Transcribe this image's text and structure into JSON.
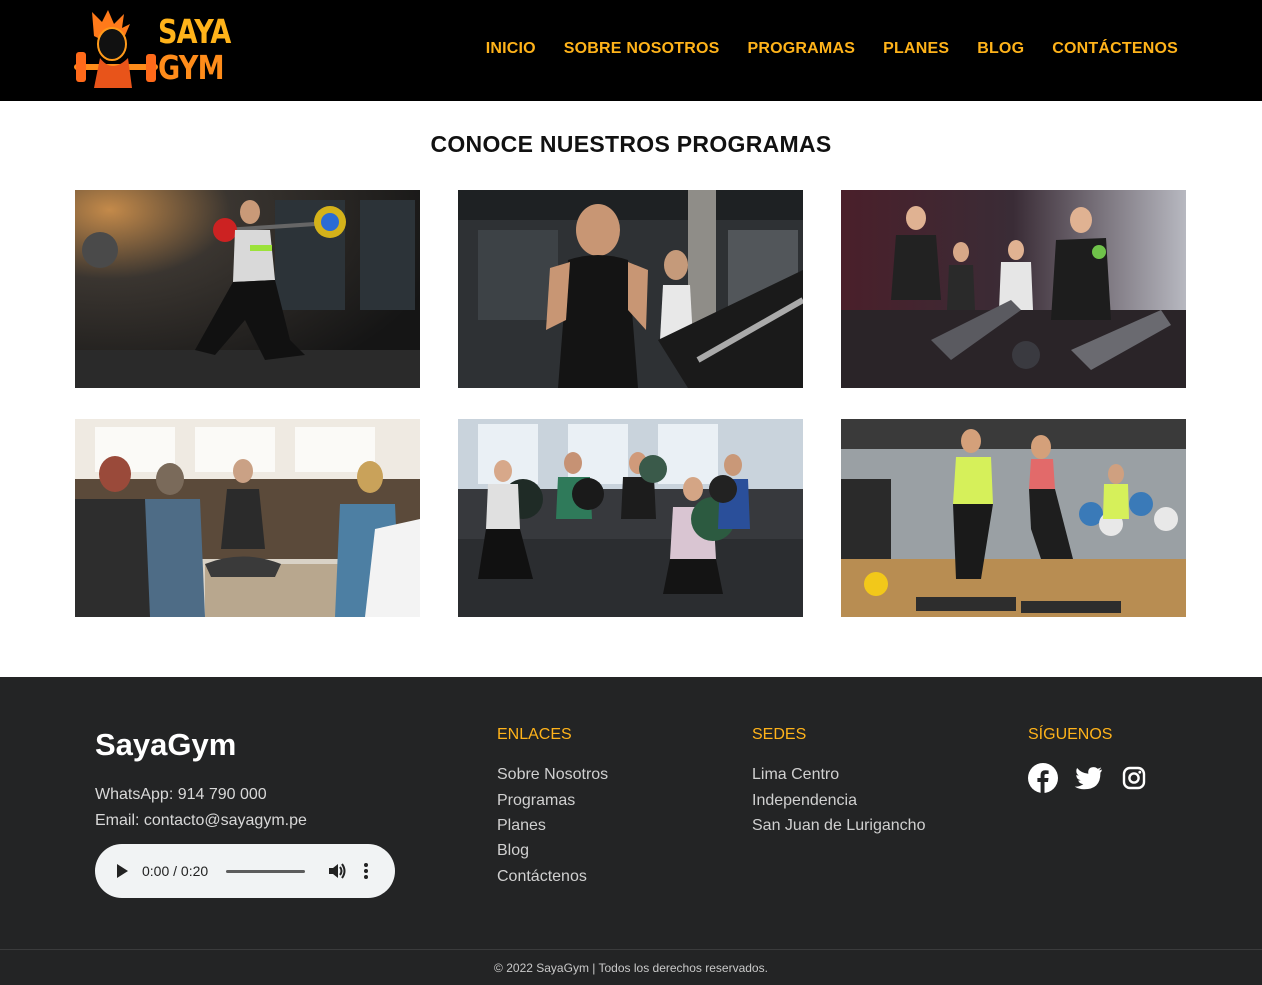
{
  "header": {
    "logo": {
      "line1": "SAYA",
      "line2": "GYM"
    },
    "nav": [
      "INICIO",
      "SOBRE NOSOTROS",
      "PROGRAMAS",
      "PLANES",
      "BLOG",
      "CONTÁCTENOS"
    ]
  },
  "main": {
    "title": "CONOCE NUESTROS PROGRAMAS"
  },
  "footer": {
    "brand": "SayaGym",
    "whatsapp": "WhatsApp: 914 790 000",
    "email": "Email: contacto@sayagym.pe",
    "audio": {
      "time": "0:00 / 0:20"
    },
    "links_title": "ENLACES",
    "links": [
      "Sobre Nosotros",
      "Programas",
      "Planes",
      "Blog",
      "Contáctenos"
    ],
    "locations_title": "SEDES",
    "locations": [
      "Lima Centro",
      "Independencia",
      "San Juan de Lurigancho"
    ],
    "social_title": "SÍGUENOS",
    "social_icons": [
      "facebook-icon",
      "twitter-icon",
      "instagram-icon"
    ],
    "copyright": "© 2022 SayaGym | Todos los derechos reservados."
  },
  "colors": {
    "accent": "#ffb31a",
    "header_bg": "#000000",
    "footer_bg": "#232425"
  }
}
